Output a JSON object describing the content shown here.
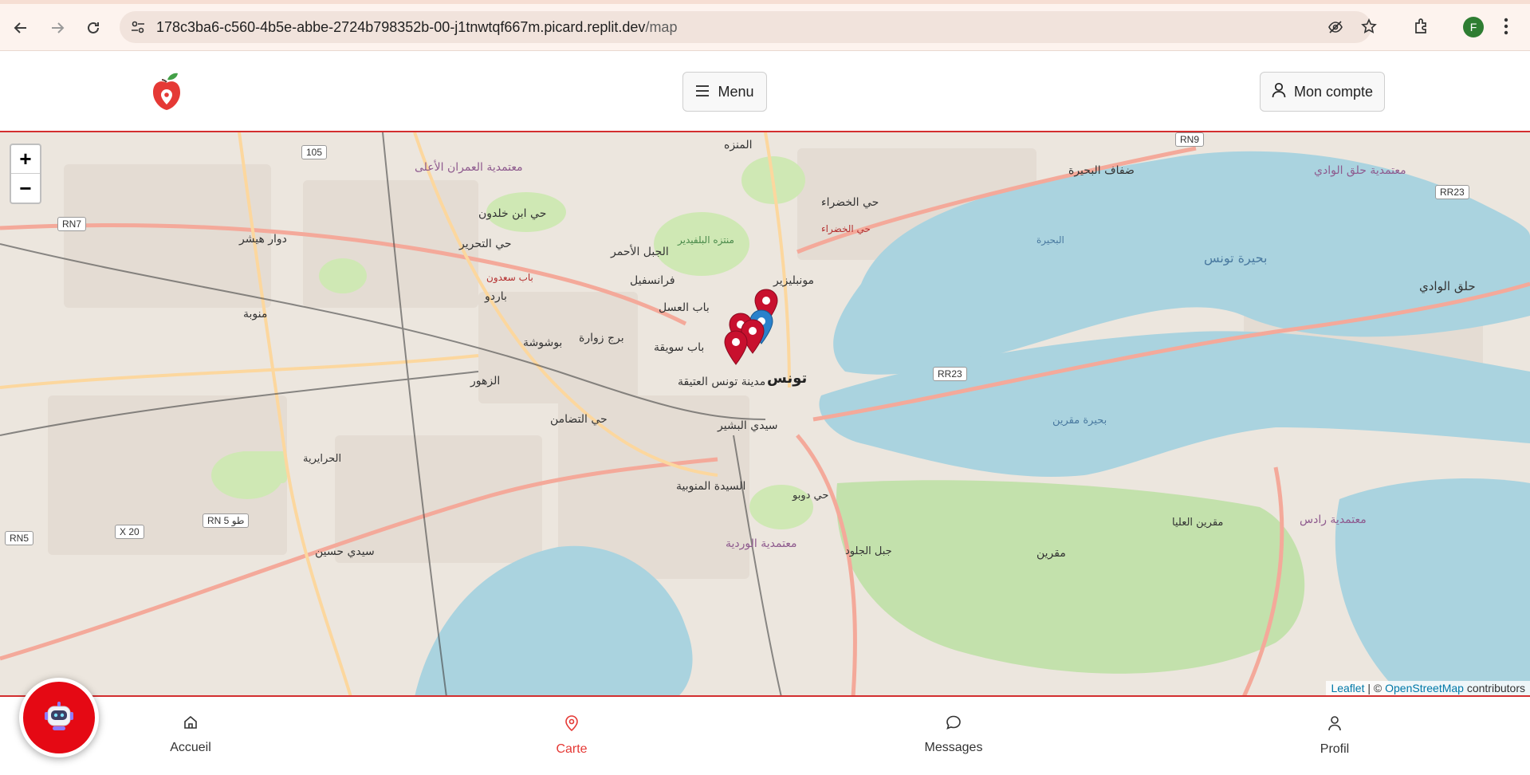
{
  "browser": {
    "url_host": "178c3ba6-c560-4b5e-abbe-2724b798352b-00-j1tnwtqf667m.picard.replit.dev",
    "url_path": "/map",
    "profile_initial": "F"
  },
  "header": {
    "menu_label": "Menu",
    "account_label": "Mon compte"
  },
  "map": {
    "zoom_in": "+",
    "zoom_out": "−",
    "attribution": {
      "leaflet": "Leaflet",
      "separator": " | © ",
      "osm": "OpenStreetMap",
      "suffix": " contributors"
    },
    "labels": {
      "lake_tunis": "بحيرة تونس",
      "lake_tunis_small": "البحيرة",
      "lake_south": "بحيرة مقرين",
      "halq_wadi": "حلق الوادي",
      "mutamadiya_halq": "معتمدية حلق الوادي",
      "tunis": "تونس",
      "medina": "مدينة تونس العتيقة",
      "bardo": "باردو",
      "manouba": "منوبة",
      "douar_hicher": "دوار هيشر",
      "ettadhamen": "حي التضامن",
      "menzah": "المنزه",
      "montplaisir": "مونبليزير",
      "lafayette": "حي الخضراء",
      "sidi_bechir": "سيدي البشير",
      "ezzouhour": "الزهور",
      "hrairia": "الحرايرية",
      "sidi_hassine": "سيدي حسين",
      "megrine": "مقرين",
      "rades": "معتمدية رادس",
      "ouardia": "معتمدية الوردية",
      "jebel_jelloud": "جبل الجلود",
      "mourouj": "مقرين العليا",
      "soukra": "ضفاف البحيرة",
      "ariana": "معتمدية العمران الأعلى",
      "belvedere": "منتزه البلفيدير",
      "bab_saadoun": "باب سعدون",
      "bab_souika": "باب سويقة",
      "bab_lassal": "باب العسل",
      "el_omrane": "حي ابن خلدون",
      "tahrir": "حي التحرير",
      "jebel_ahmar": "الجبل الأحمر",
      "fransvil": "فرانسفيل",
      "borj_zouara": "برج زوارة",
      "boushousha": "بوشوشة",
      "djebel_jelloud2": "حي دوبو",
      "saida_manoubia": "السيدة المنوبية",
      "hay_khadra": "حي الخضراء",
      "rn7": "RN7",
      "rn5": "RN5",
      "rn9": "RN9",
      "rr23a": "RR23",
      "rr23b": "RR23",
      "x20": "X 20",
      "rn5b": "RN 5 طو",
      "r105": "105"
    }
  },
  "bottom_nav": {
    "home": "Accueil",
    "map": "Carte",
    "messages": "Messages",
    "profile": "Profil"
  },
  "colors": {
    "accent": "#e53935",
    "header_border": "#d32f2f",
    "water": "#aad3df",
    "land": "#efe9e1",
    "park": "#c8e6a8"
  },
  "icons": {
    "back": "arrow-left-icon",
    "forward": "arrow-right-icon",
    "reload": "reload-icon",
    "site_info": "tune-icon",
    "eye_off": "eye-off-icon",
    "star": "star-icon",
    "extensions": "puzzle-icon",
    "more": "more-vert-icon",
    "menu": "hamburger-icon",
    "account": "user-icon",
    "home": "home-icon",
    "map_pin": "map-pin-icon",
    "messages": "chat-icon",
    "profile": "user-icon",
    "bot": "robot-icon"
  }
}
